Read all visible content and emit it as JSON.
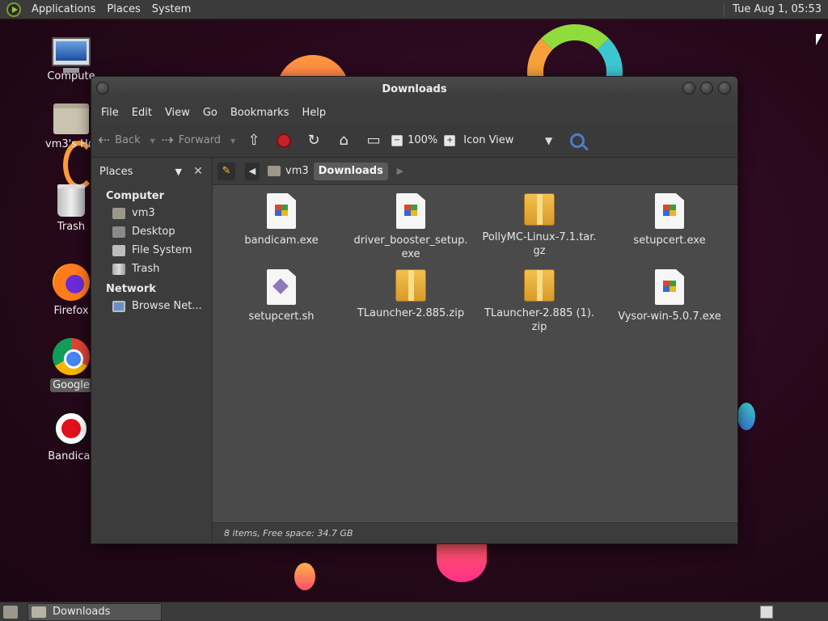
{
  "top_panel": {
    "menus": [
      "Applications",
      "Places",
      "System"
    ],
    "clock": "Tue Aug  1, 05:53"
  },
  "desktop": {
    "icons": [
      {
        "label": "Compute",
        "icon": "computer-icon"
      },
      {
        "label": "vm3's Hor",
        "icon": "home-folder-icon"
      },
      {
        "label": "Trash",
        "icon": "trash-icon"
      },
      {
        "label": "Firefox",
        "icon": "firefox-icon"
      },
      {
        "label": "Google",
        "icon": "chrome-icon"
      },
      {
        "label": "Bandicar",
        "icon": "bandicam-icon"
      }
    ]
  },
  "window": {
    "title": "Downloads",
    "menu": [
      "File",
      "Edit",
      "View",
      "Go",
      "Bookmarks",
      "Help"
    ],
    "toolbar": {
      "back": "Back",
      "forward": "Forward",
      "zoom": "100%",
      "view_mode": "Icon View"
    },
    "sidebar": {
      "selector": "Places",
      "sections": [
        {
          "heading": "Computer",
          "items": [
            "vm3",
            "Desktop",
            "File System",
            "Trash"
          ]
        },
        {
          "heading": "Network",
          "items": [
            "Browse Net..."
          ]
        }
      ]
    },
    "pathbar": {
      "crumbs": [
        "vm3",
        "Downloads"
      ]
    },
    "files": [
      {
        "name": "bandicam.exe",
        "type": "exe"
      },
      {
        "name": "driver_booster_setup.\nexe",
        "type": "exe"
      },
      {
        "name": "PollyMC-Linux-7.1.tar.\ngz",
        "type": "pkg"
      },
      {
        "name": "setupcert.exe",
        "type": "exe"
      },
      {
        "name": "setupcert.sh",
        "type": "sh"
      },
      {
        "name": "TLauncher-2.885.zip",
        "type": "pkg"
      },
      {
        "name": "TLauncher-2.885 (1).\nzip",
        "type": "pkg"
      },
      {
        "name": "Vysor-win-5.0.7.exe",
        "type": "exe"
      }
    ],
    "status": "8 items, Free space: 34.7 GB"
  },
  "taskbar": {
    "tasks": [
      "Downloads"
    ]
  }
}
